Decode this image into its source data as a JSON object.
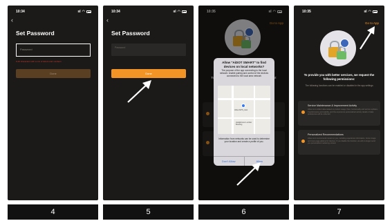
{
  "phones": [
    {
      "caption": "4",
      "status": {
        "time": "10:34",
        "signal": "ııl"
      },
      "back_glyph": "‹",
      "title": "Set Password",
      "input_placeholder": "Password",
      "error_text": "6-20 characters with a mix of letters and numbers",
      "done_label": "Done"
    },
    {
      "caption": "5",
      "status": {
        "time": "10:34",
        "signal": "ııl"
      },
      "back_glyph": "‹",
      "title": "Set Password",
      "input_placeholder": "Password",
      "done_label": "Done"
    },
    {
      "caption": "6",
      "status": {
        "time": "10:35",
        "signal": "ııl"
      },
      "goto_label": "Go to App",
      "bg_text": "To provide you with better services, we request",
      "dialog": {
        "title": "Allow \"AiDOT SMART\" to find devices on local networks?",
        "body": "The purpose of the app connecting to the local network: enable pairing and control of the devices connected to the local area network",
        "map_label_1": "Allow AIPS_Asst",
        "map_label_2": "Hodgkinson Lumber Brewing",
        "info": "Information from networks can be used to determine your location and create a profile of you.",
        "dont_allow": "Don't Allow",
        "allow": "Allow"
      }
    },
    {
      "caption": "7",
      "status": {
        "time": "10:35",
        "signal": "ııl"
      },
      "goto_label": "Go to App",
      "intro": "To provide you with better services, we request the following permissions:",
      "sub": "The following functions can be enabled or disabled in the app settings",
      "cards": [
        {
          "title": "Service Maintenance & Improvement Activity",
          "desc": "Allow us to collect data related to product usage, fixes, functionality and service updates, if performance and stability, and the experience personalized activity details of data preferences will be collected"
        },
        {
          "title": "Personalized Recommendations",
          "desc": "Allow us to recommend content to you, including experience information, home image, and more page addons for devices. If you disable the function, we will no longer send you personalized marketing content"
        }
      ]
    }
  ],
  "colors": {
    "accent": "#f29526",
    "background": "#1c1a18",
    "error": "#c8382d",
    "link": "#2f6fe0"
  }
}
